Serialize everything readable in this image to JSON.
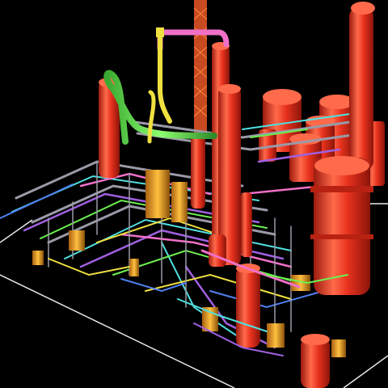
{
  "scene": {
    "background_color": "#000000",
    "floor_outline_color": "#e8e8e8",
    "colors": {
      "vessel_red": "#e8321e",
      "vessel_shade": "#9c1a0e",
      "vessel_highlight": "#ff6a4a",
      "pipe_green": "#6cf050",
      "pipe_yellow": "#f0e040",
      "pipe_pink": "#f070c8",
      "pipe_orange": "#f0a020",
      "pipe_cyan": "#50e0e0",
      "pipe_purple": "#a060e0",
      "pipe_gray": "#9a9aa8",
      "pipe_blue": "#5080f0"
    },
    "objects": [
      "tall-column-left",
      "tall-column-center",
      "stack-flare",
      "tall-column-right",
      "spherical-tanks",
      "large-vessel-right",
      "pipe-racks",
      "elevated-green-pipe",
      "elevated-pink-pipe",
      "pumps-and-valves"
    ]
  }
}
